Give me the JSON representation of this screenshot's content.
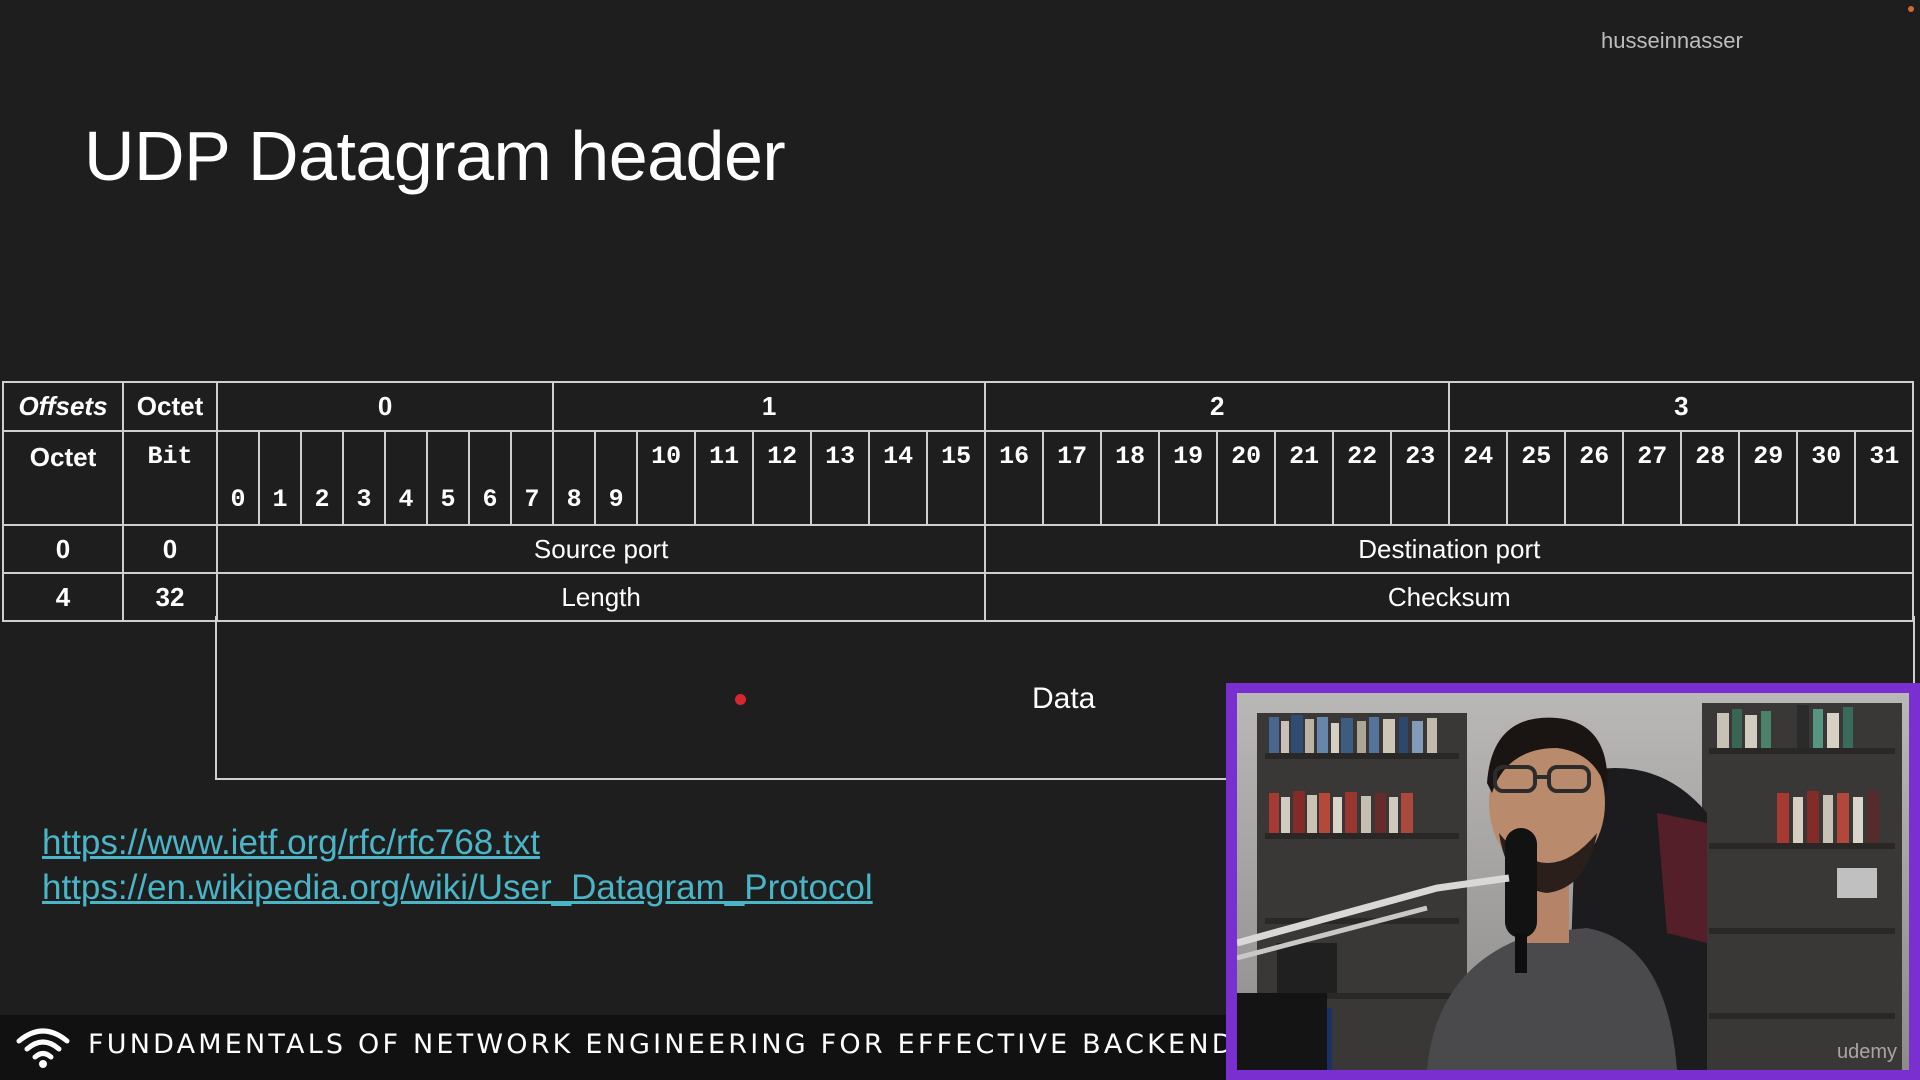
{
  "watermark": "husseinnasser",
  "slide": {
    "title": "UDP Datagram header"
  },
  "table": {
    "header_offsets": "Offsets",
    "header_octet": "Octet",
    "octet_groups": [
      "0",
      "1",
      "2",
      "3"
    ],
    "row2_octet_label": "Octet",
    "row2_bit_label": "Bit",
    "bits": [
      "0",
      "1",
      "2",
      "3",
      "4",
      "5",
      "6",
      "7",
      "8",
      "9",
      "10",
      "11",
      "12",
      "13",
      "14",
      "15",
      "16",
      "17",
      "18",
      "19",
      "20",
      "21",
      "22",
      "23",
      "24",
      "25",
      "26",
      "27",
      "28",
      "29",
      "30",
      "31"
    ],
    "rows": [
      {
        "octet": "0",
        "bit": "0",
        "left_field": "Source port",
        "right_field": "Destination port"
      },
      {
        "octet": "4",
        "bit": "32",
        "left_field": "Length",
        "right_field": "Checksum"
      }
    ],
    "data_label": "Data"
  },
  "links": [
    "https://www.ietf.org/rfc/rfc768.txt",
    "https://en.wikipedia.org/wiki/User_Datagram_Protocol"
  ],
  "footer": {
    "course_title": "FUNDAMENTALS OF NETWORK ENGINEERING FOR EFFECTIVE BACKENDS",
    "icon": "wifi-icon"
  },
  "webcam": {
    "corner_mark": "udemy",
    "frame_color": "#7a2fd0"
  },
  "colors": {
    "background": "#1e1e1e",
    "link": "#4ab5c7",
    "pointer": "#d9262e",
    "grid": "#cfcfcf"
  }
}
